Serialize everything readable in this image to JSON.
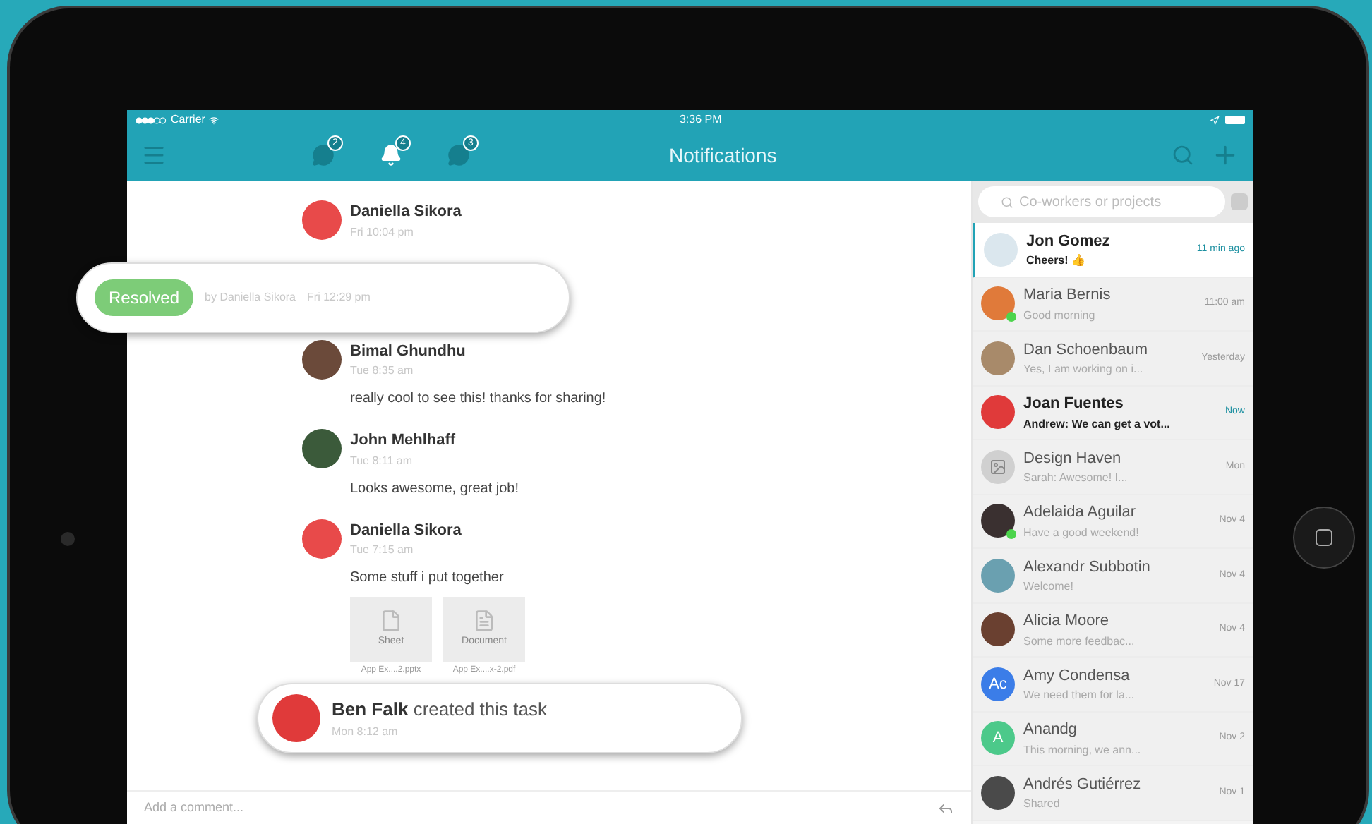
{
  "status_bar": {
    "carrier": "Carrier",
    "time": "3:36 PM"
  },
  "nav": {
    "title": "Notifications",
    "badges": [
      {
        "kind": "chat",
        "count": "2",
        "selected": false
      },
      {
        "kind": "bell",
        "count": "4",
        "selected": true
      },
      {
        "kind": "chat",
        "count": "3",
        "selected": false
      }
    ]
  },
  "messages": [
    {
      "kind": "text",
      "author": "Daniella Sikora",
      "time": "Fri 10:04 pm",
      "avatar": {
        "color": "#e84a4a"
      }
    },
    {
      "kind": "text",
      "author": "Bimal Ghundhu",
      "time": "Tue 8:35 am",
      "text": "really cool to see this! thanks for sharing!",
      "avatar": {
        "color": "#6b4a3a"
      }
    },
    {
      "kind": "text",
      "author": "John Mehlhaff",
      "time": "Tue 8:11 am",
      "text": "Looks awesome, great job!",
      "avatar": {
        "color": "#3b5a3a"
      }
    },
    {
      "kind": "files",
      "author": "Daniella Sikora",
      "time": "Tue 7:15 am",
      "text": "Some stuff i put together",
      "avatar": {
        "color": "#e84a4a"
      },
      "files": [
        {
          "label": "Sheet",
          "name": "App Ex....2.pptx"
        },
        {
          "label": "Document",
          "name": "App Ex....x-2.pdf"
        }
      ]
    }
  ],
  "resolved": {
    "badge": "Resolved",
    "by": "by Daniella Sikora",
    "time": "Fri 12:29 pm"
  },
  "task": {
    "author": "Ben Falk",
    "action": "created this task",
    "time": "Mon 8:12 am"
  },
  "composer": {
    "placeholder": "Add a comment..."
  },
  "search": {
    "placeholder": "Co-workers or projects"
  },
  "conversations": [
    {
      "name": "Jon Gomez",
      "preview": "Cheers! 👍",
      "time": "11 min ago",
      "unread": true,
      "selected": true,
      "online": false,
      "avatar": {
        "kind": "photo",
        "color": "#dbe7ee"
      }
    },
    {
      "name": "Maria Bernis",
      "preview": "Good morning",
      "time": "11:00 am",
      "unread": false,
      "selected": false,
      "online": true,
      "avatar": {
        "kind": "photo",
        "color": "#e07a3a"
      }
    },
    {
      "name": "Dan Schoenbaum",
      "preview": "Yes, I am working on i...",
      "time": "Yesterday",
      "unread": false,
      "selected": false,
      "online": false,
      "avatar": {
        "kind": "photo",
        "color": "#a88a6a"
      }
    },
    {
      "name": "Joan Fuentes",
      "preview": "Andrew: We can get a vot...",
      "time": "Now",
      "unread": true,
      "selected": false,
      "online": false,
      "avatar": {
        "kind": "photo",
        "color": "#e03a3a"
      }
    },
    {
      "name": "Design Haven",
      "preview": "Sarah: Awesome! I...",
      "time": "Mon",
      "unread": false,
      "selected": false,
      "online": false,
      "avatar": {
        "kind": "group",
        "color": "#d0d0d0"
      }
    },
    {
      "name": "Adelaida Aguilar",
      "preview": "Have a good weekend!",
      "time": "Nov 4",
      "unread": false,
      "selected": false,
      "online": true,
      "avatar": {
        "kind": "photo",
        "color": "#3a3030"
      }
    },
    {
      "name": "Alexandr Subbotin",
      "preview": "Welcome!",
      "time": "Nov 4",
      "unread": false,
      "selected": false,
      "online": false,
      "avatar": {
        "kind": "photo",
        "color": "#6aa0b0"
      }
    },
    {
      "name": "Alicia Moore",
      "preview": "Some more feedbac...",
      "time": "Nov 4",
      "unread": false,
      "selected": false,
      "online": false,
      "avatar": {
        "kind": "photo",
        "color": "#6a4030"
      }
    },
    {
      "name": "Amy Condensa",
      "preview": "We need them for la...",
      "time": "Nov 17",
      "unread": false,
      "selected": false,
      "online": false,
      "avatar": {
        "kind": "initials",
        "initials": "Ac",
        "color": "#3b7de8"
      }
    },
    {
      "name": "Anandg",
      "preview": "This morning, we ann...",
      "time": "Nov 2",
      "unread": false,
      "selected": false,
      "online": false,
      "avatar": {
        "kind": "initials",
        "initials": "A",
        "color": "#4cc98a"
      }
    },
    {
      "name": "Andrés Gutiérrez",
      "preview": "Shared",
      "time": "Nov 1",
      "unread": false,
      "selected": false,
      "online": false,
      "avatar": {
        "kind": "photo",
        "color": "#4a4a4a"
      }
    }
  ]
}
